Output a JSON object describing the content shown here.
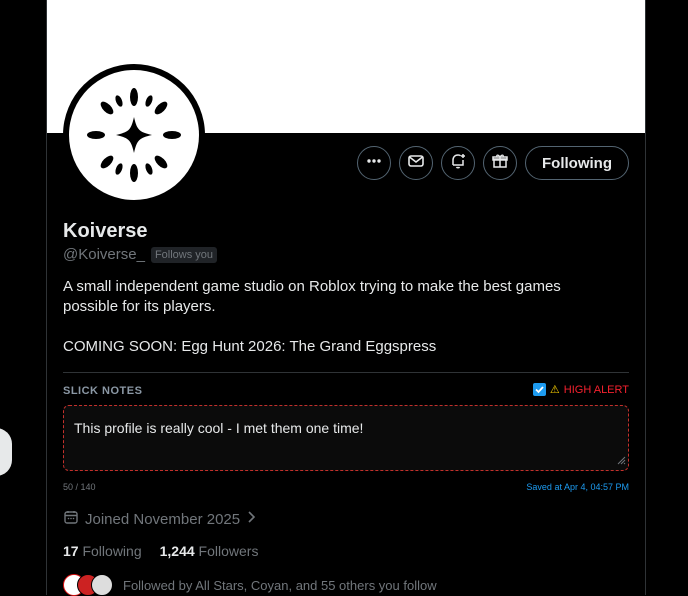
{
  "profile": {
    "name": "Koiverse",
    "handle": "@Koiverse_",
    "follows_you": "Follows you",
    "bio_line1": "A small independent game studio on Roblox trying to make the best games possible for its players.",
    "bio_line2": "COMING SOON: Egg Hunt 2026: The Grand Eggspress",
    "joined": "Joined November 2025",
    "following_count": "17",
    "following_label": "Following",
    "followers_count": "1,244",
    "followers_label": "Followers",
    "followed_by": "Followed by All Stars, Coyan, and 55 others you follow"
  },
  "actions": {
    "more_icon": "more-horizontal-icon",
    "message_icon": "envelope-icon",
    "notify_icon": "bell-plus-icon",
    "gift_icon": "gift-icon",
    "follow_label": "Following"
  },
  "notes": {
    "title": "SLICK NOTES",
    "alert_label": "HIGH ALERT",
    "alert_checked": true,
    "text": "This profile is really cool - I met them one time!",
    "counter": "50 / 140",
    "saved": "Saved at Apr 4, 04:57 PM"
  },
  "colors": {
    "background": "#000000",
    "text": "#e7e9ea",
    "muted": "#71767b",
    "accent": "#1d9bf0",
    "alert": "#f4212e",
    "warning": "#ffd400"
  }
}
